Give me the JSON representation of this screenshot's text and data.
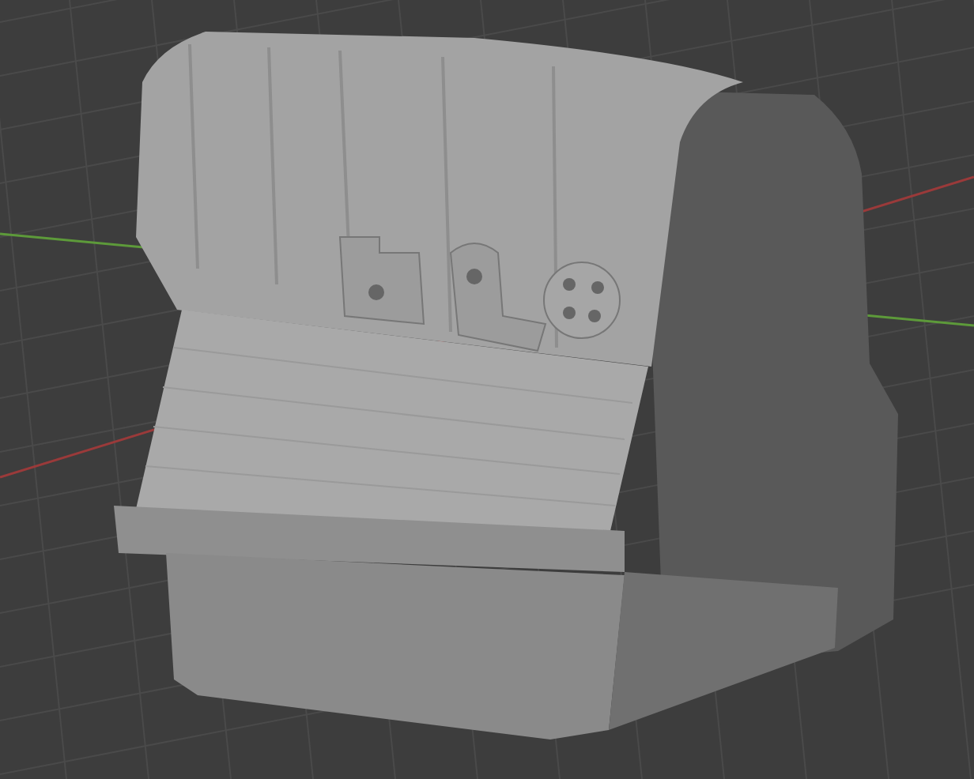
{
  "viewport": {
    "show_grid": true,
    "show_x_axis": true,
    "show_y_axis": true
  }
}
